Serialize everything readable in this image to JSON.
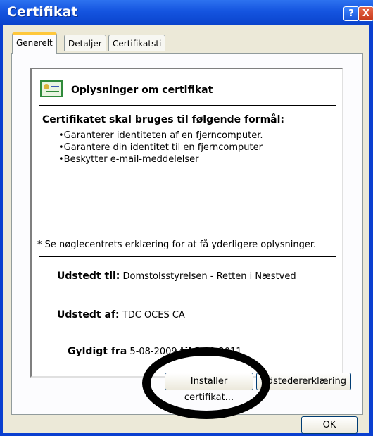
{
  "window": {
    "title": "Certifikat",
    "help_symbol": "?",
    "close_symbol": "X"
  },
  "tabs": [
    {
      "label": "Generelt"
    },
    {
      "label": "Detaljer"
    },
    {
      "label": "Certifikatsti"
    }
  ],
  "info": {
    "icon": "certificate-icon",
    "heading": "Oplysninger om certifikat",
    "purpose_title": "Certifikatet skal bruges til følgende formål:",
    "purposes": [
      "Garanterer identiteten af en fjerncomputer.",
      "Garantere din identitet til en fjerncomputer",
      "Beskytter e-mail-meddelelser"
    ],
    "footnote": "* Se nøglecentrets erklæring for at få yderligere oplysninger.",
    "issued_to_label": "Udstedt til:",
    "issued_to_value": "Domstolsstyrelsen - Retten i Næstved",
    "issued_by_label": "Udstedt af:",
    "issued_by_value": "TDC OCES CA",
    "valid_from_label": "Gyldigt fra",
    "valid_from_value": "5-08-2009",
    "valid_to_label": "til",
    "valid_to_value": "5-08-2011"
  },
  "buttons": {
    "install": "Installer certifikat...",
    "issuer_statement": "dstedererklæring",
    "ok": "OK"
  },
  "colors": {
    "titlebar": "#0a43cc",
    "dialog_bg": "#ece9d8",
    "tab_highlight": "#ffc83c",
    "annotation_circle": "#000000"
  }
}
